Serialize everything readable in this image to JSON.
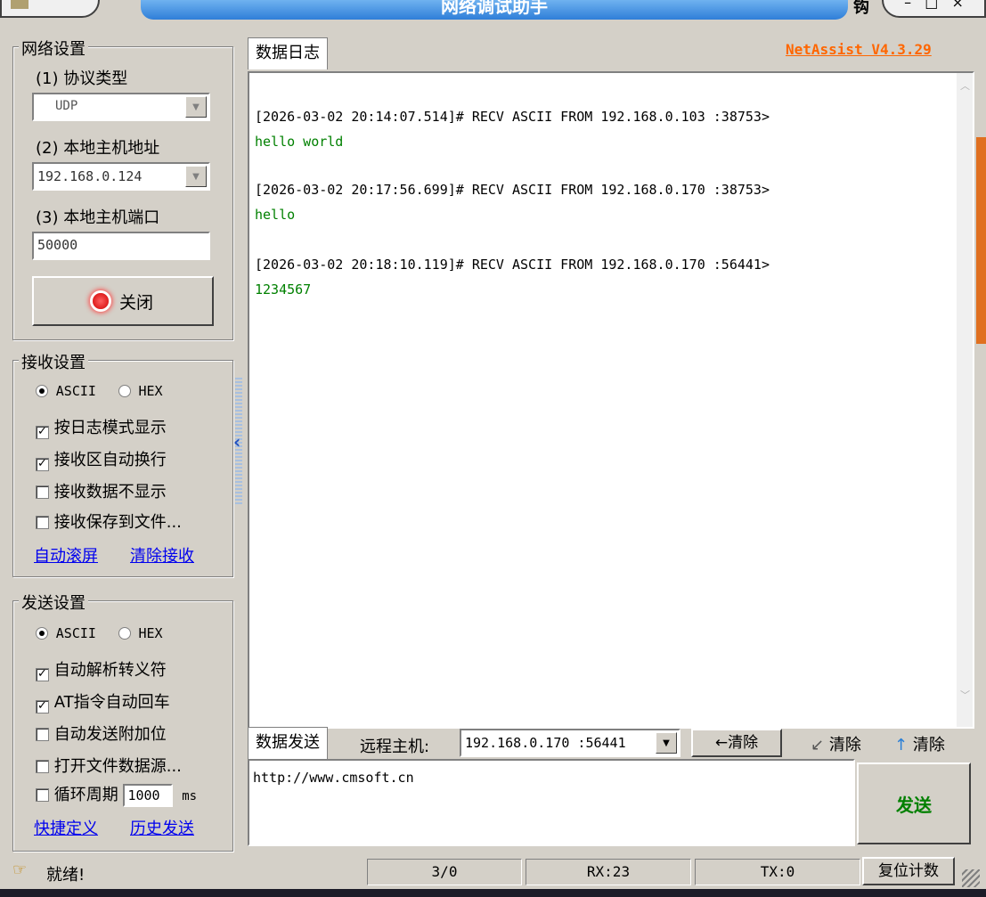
{
  "title_bar": {
    "title": "网络调试助手",
    "right_glyph": "钩"
  },
  "version": "NetAssist V4.3.29",
  "network_settings": {
    "title": "网络设置",
    "protocol_label": "(1) 协议类型",
    "protocol_value": "UDP",
    "host_label": "(2) 本地主机地址",
    "host_value": "192.168.0.124",
    "port_label": "(3) 本地主机端口",
    "port_value": "50000",
    "close_button": "关闭"
  },
  "receive_settings": {
    "title": "接收设置",
    "ascii": "ASCII",
    "hex": "HEX",
    "options": [
      "按日志模式显示",
      "接收区自动换行",
      "接收数据不显示",
      "接收保存到文件..."
    ],
    "link_autoscroll": "自动滚屏",
    "link_clear": "清除接收"
  },
  "send_settings": {
    "title": "发送设置",
    "ascii": "ASCII",
    "hex": "HEX",
    "options": [
      "自动解析转义符",
      "AT指令自动回车",
      "自动发送附加位",
      "打开文件数据源..."
    ],
    "loop_label": "循环周期",
    "loop_value": "1000",
    "loop_unit": "ms",
    "link_shortcut": "快捷定义",
    "link_history": "历史发送"
  },
  "log": {
    "tab": "数据日志",
    "entries": [
      {
        "header": "[2026-03-02 20:14:07.514]# RECV ASCII FROM 192.168.0.103 :38753>",
        "data": "hello world"
      },
      {
        "header": "[2026-03-02 20:17:56.699]# RECV ASCII FROM 192.168.0.170 :38753>",
        "data": "hello"
      },
      {
        "header": "[2026-03-02 20:18:10.119]# RECV ASCII FROM 192.168.0.170 :56441>",
        "data": "1234567"
      }
    ]
  },
  "send_bar": {
    "tab": "数据发送",
    "remote_label": "远程主机:",
    "remote_value": "192.168.0.170 :56441",
    "clear1": "清除",
    "clear2": "清除",
    "clear3": "清除",
    "send_text": "http://www.cmsoft.cn",
    "send_button": "发送"
  },
  "status_bar": {
    "ready": "就绪!",
    "count": "3/0",
    "rx": "RX:23",
    "tx": "TX:0",
    "reset": "复位计数"
  },
  "colors": {
    "title_bar": "#3a8ee6",
    "data_green": "#008000",
    "version_orange": "#ff6600",
    "send_green": "#008000"
  }
}
